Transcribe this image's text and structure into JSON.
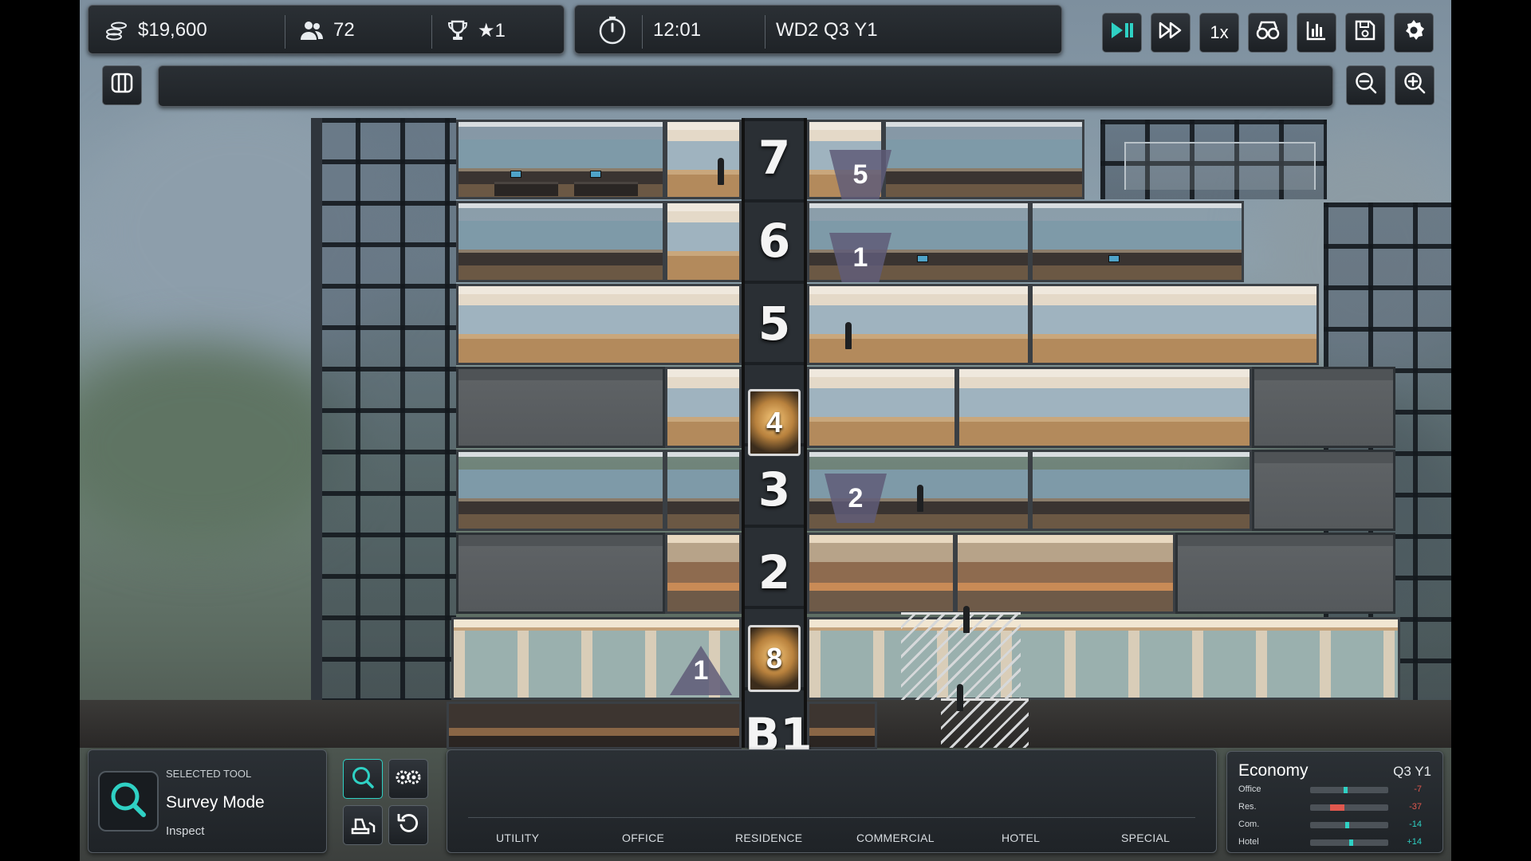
{
  "hud": {
    "money": "$19,600",
    "population": "72",
    "rating": "★1",
    "time": "12:01",
    "date": "WD2 Q3 Y1",
    "speed_label": "1x"
  },
  "building": {
    "floor_labels": [
      "7",
      "6",
      "5",
      "3",
      "2",
      "B1"
    ],
    "elevator_cars": [
      "4",
      "8"
    ],
    "queue_markers": [
      "5",
      "1",
      "2",
      "1"
    ]
  },
  "tool_panel": {
    "caption": "SELECTED TOOL",
    "tool_name": "Survey Mode",
    "tool_sub": "Inspect"
  },
  "categories": [
    "UTILITY",
    "OFFICE",
    "RESIDENCE",
    "COMMERCIAL",
    "HOTEL",
    "SPECIAL"
  ],
  "economy": {
    "title": "Economy",
    "period": "Q3 Y1",
    "rows": [
      {
        "label": "Office",
        "value": "-7",
        "level": 0.45,
        "color": "#2fd1c4",
        "value_color": "#e0584e"
      },
      {
        "label": "Res.",
        "value": "-37",
        "level": 0.35,
        "color": "#e0584e",
        "value_color": "#e0584e"
      },
      {
        "label": "Com.",
        "value": "-14",
        "level": 0.47,
        "color": "#2fd1c4",
        "value_color": "#2fd1c4"
      },
      {
        "label": "Hotel",
        "value": "+14",
        "level": 0.52,
        "color": "#2fd1c4",
        "value_color": "#2fd1c4"
      }
    ]
  },
  "colors": {
    "accent": "#2fd1c4",
    "negative": "#e0584e",
    "panel": "#23282d"
  },
  "icons": [
    "coins-icon",
    "people-icon",
    "trophy-icon",
    "clock-icon",
    "play-pause-icon",
    "fast-forward-icon",
    "goggles-icon",
    "bar-chart-icon",
    "save-icon",
    "gear-icon",
    "map-toggle-icon",
    "zoom-out-icon",
    "zoom-in-icon",
    "search-icon",
    "settings-gears-icon",
    "bulldoze-icon",
    "undo-icon"
  ]
}
